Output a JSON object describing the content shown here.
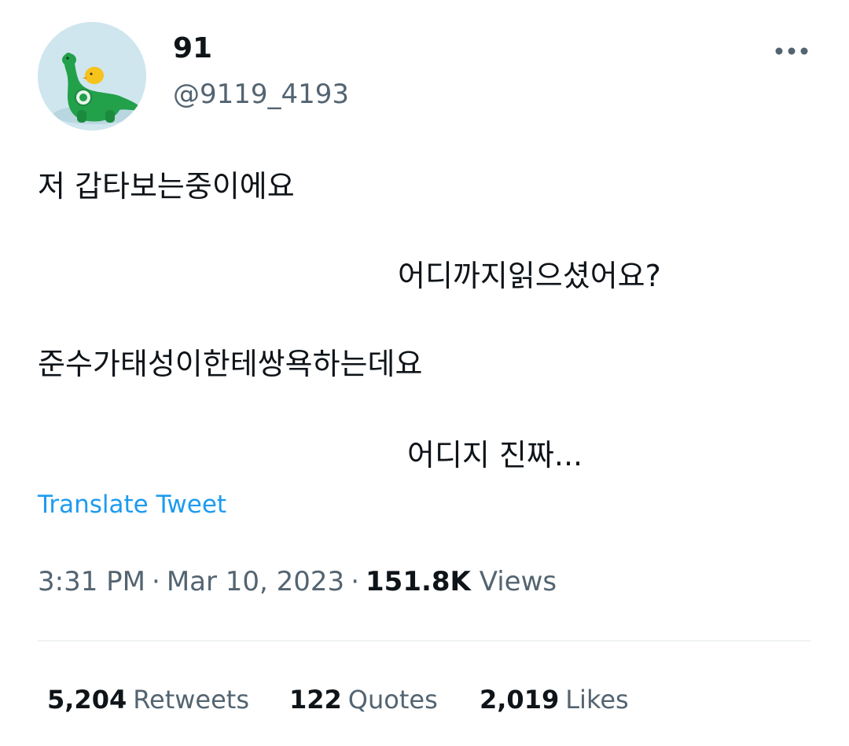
{
  "user": {
    "display_name": "91",
    "handle": "@9119_4193",
    "avatar_icon": "green-dinosaur-plush-avatar"
  },
  "more_icon": "more-dots-icon",
  "tweet": {
    "lines": [
      "저 갑타보는중이에요",
      "어디까지읽으셨어요?",
      "준수가태성이한테쌍욕하는데요",
      "어디지 진짜..."
    ],
    "translate_label": "Translate Tweet"
  },
  "meta": {
    "time": "3:31 PM",
    "date": "Mar 10, 2023",
    "separator": "·",
    "views_count": "151.8K",
    "views_label": "Views"
  },
  "stats": {
    "retweets_count": "5,204",
    "retweets_label": "Retweets",
    "quotes_count": "122",
    "quotes_label": "Quotes",
    "likes_count": "2,019",
    "likes_label": "Likes"
  },
  "colors": {
    "link": "#1d9bf0",
    "text_primary": "#0f1419",
    "text_secondary": "#536471",
    "divider": "#eff3f4"
  }
}
